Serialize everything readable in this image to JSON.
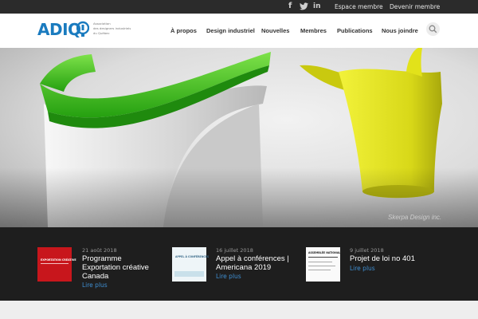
{
  "topbar": {
    "social": [
      {
        "icon": "facebook-icon",
        "glyph": "f"
      },
      {
        "icon": "twitter-icon",
        "glyph": "🐦"
      },
      {
        "icon": "linkedin-icon",
        "glyph": "in"
      }
    ],
    "links": [
      "Espace membre",
      "Devenir membre"
    ]
  },
  "header": {
    "logo": "ADIQ",
    "logo_sub": [
      "Association",
      "des designers industriels",
      "du Québec"
    ],
    "nav": [
      "À propos",
      "Design industriel",
      "Nouvelles",
      "Membres",
      "Publications",
      "Nous joindre"
    ],
    "search_icon": "search-icon"
  },
  "hero": {
    "credit": "Skerpa Design inc."
  },
  "news": [
    {
      "date": "21 août 2018",
      "title_lines": [
        "Programme",
        "Exportation créative",
        "Canada"
      ],
      "more": "Lire plus",
      "thumb_text": "EXPORTATION CRÉATIVE"
    },
    {
      "date": "16 juillet 2018",
      "title_lines": [
        "Appel à conférences |",
        "Americana 2019"
      ],
      "more": "Lire plus",
      "thumb_text": "APPEL À CONFÉRENCES"
    },
    {
      "date": "9 juillet 2018",
      "title_lines": [
        "Projet de loi no 401"
      ],
      "more": "Lire plus",
      "thumb_text": "ASSEMBLÉE NATIONALE"
    }
  ],
  "colors": {
    "brand": "#1a7bbf",
    "topbar": "#2b2b2b",
    "news_bg": "#1e1e1e",
    "link": "#3f8fd2",
    "green_product": "#3fbf1f",
    "yellow_product": "#e2e21a"
  }
}
